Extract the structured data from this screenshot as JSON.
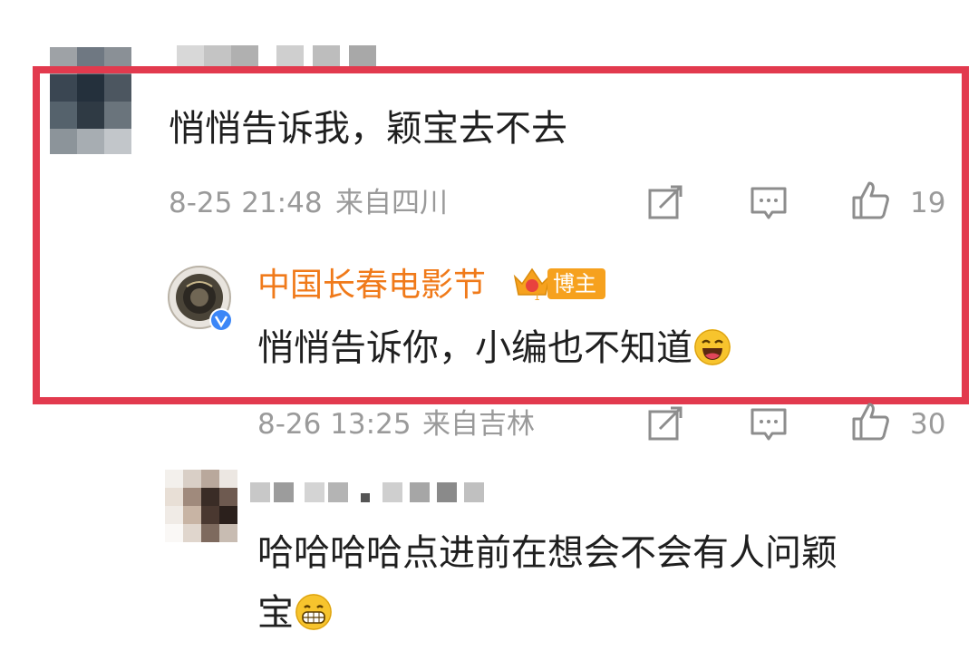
{
  "comment1": {
    "text": "悄悄告诉我，颖宝去不去",
    "time": "8-25 21:48",
    "source": "来自四川",
    "likes": "19"
  },
  "reply": {
    "author": "中国长春电影节",
    "badge": "博主",
    "text": "悄悄告诉你，小编也不知道",
    "emoji": "laughing-emoji",
    "time": "8-26 13:25",
    "source": "来自吉林",
    "likes": "30"
  },
  "comment2": {
    "text_line1": "哈哈哈哈点进前在想会不会有人问颖",
    "text_line2": "宝",
    "emoji": "grinning-emoji"
  },
  "colors": {
    "highlight": "#e23a4e",
    "author_orange": "#f07a1a",
    "badge_bg": "#f6a11e",
    "meta_gray": "#9a9a9a"
  }
}
